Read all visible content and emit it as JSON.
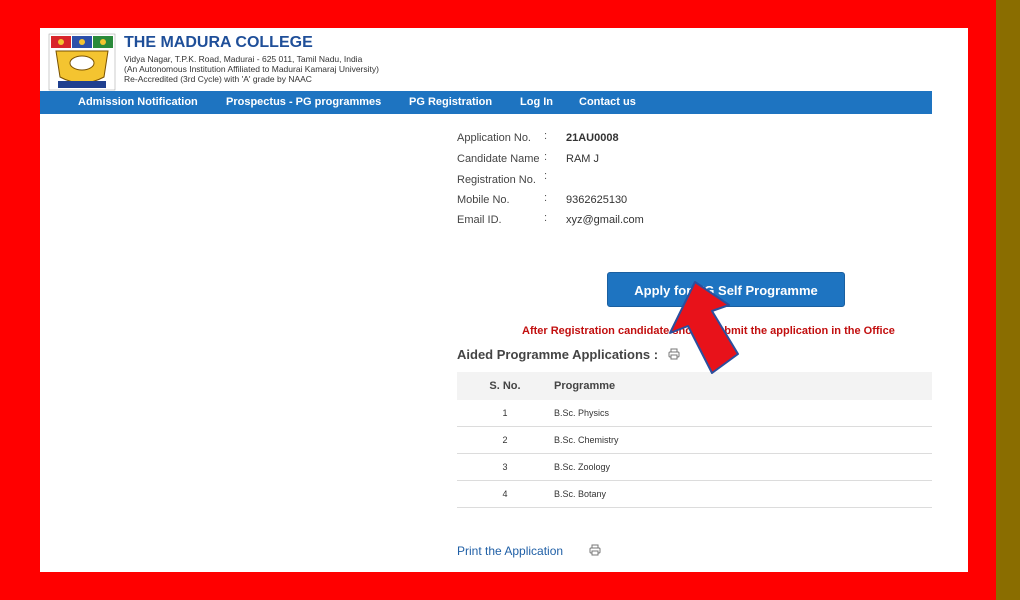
{
  "college": {
    "name": "THE MADURA COLLEGE",
    "address_line1": "Vidya Nagar, T.P.K. Road, Madurai - 625 011, Tamil Nadu, India",
    "address_line2": "(An Autonomous Institution Affiliated to Madurai Kamaraj University)",
    "address_line3": "Re-Accredited (3rd Cycle) with 'A' grade by NAAC"
  },
  "nav": {
    "items": [
      {
        "label": "Admission Notification"
      },
      {
        "label": "Prospectus - PG programmes"
      },
      {
        "label": "PG Registration"
      },
      {
        "label": "Log In"
      },
      {
        "label": "Contact us"
      }
    ]
  },
  "applicant": {
    "fields": [
      {
        "label": "Application No.",
        "value": "21AU0008"
      },
      {
        "label": "Candidate Name",
        "value": "RAM J"
      },
      {
        "label": "Registration No.",
        "value": ""
      },
      {
        "label": "Mobile No.",
        "value": "9362625130"
      },
      {
        "label": "Email ID.",
        "value": "xyz@gmail.com"
      }
    ],
    "colon": ":"
  },
  "apply_button": {
    "label": "Apply for UG Self Programme"
  },
  "notice": "After Registration candidate should submit the application in the Office",
  "aided": {
    "title": "Aided Programme Applications :",
    "headers": {
      "sno": "S. No.",
      "programme": "Programme"
    },
    "rows": [
      {
        "sno": "1",
        "programme": "B.Sc. Physics"
      },
      {
        "sno": "2",
        "programme": "B.Sc. Chemistry"
      },
      {
        "sno": "3",
        "programme": "B.Sc. Zoology"
      },
      {
        "sno": "4",
        "programme": "B.Sc. Botany"
      }
    ]
  },
  "print_link": "Print the Application",
  "colors": {
    "nav_blue": "#1e74c1",
    "frame_red": "#ff0000",
    "notice_red": "#c20f0f",
    "arrow_red": "#e8121a",
    "arrow_outline": "#2b4f9e"
  }
}
